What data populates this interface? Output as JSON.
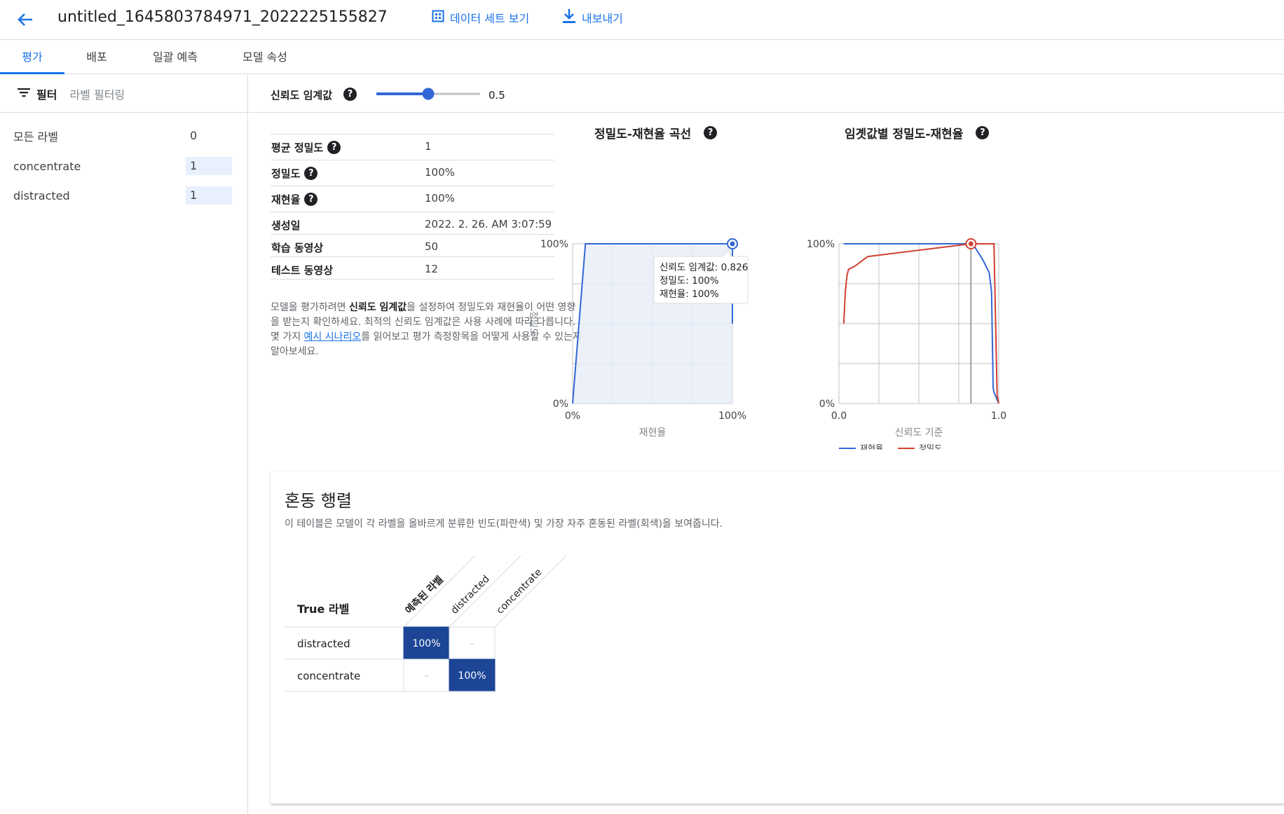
{
  "header": {
    "title": "untitled_1645803784971_2022225155827",
    "view_dataset_label": "데이터 세트 보기",
    "export_label": "내보내기"
  },
  "tabs": [
    {
      "label": "평가",
      "active": true
    },
    {
      "label": "배포",
      "active": false
    },
    {
      "label": "일괄 예측",
      "active": false
    },
    {
      "label": "모델 속성",
      "active": false
    }
  ],
  "sidebar": {
    "filter_label": "필터",
    "filter_placeholder": "라벨 필터링",
    "labels": [
      {
        "name": "모든 라벨",
        "count": "0"
      },
      {
        "name": "concentrate",
        "count": "1"
      },
      {
        "name": "distracted",
        "count": "1"
      }
    ]
  },
  "threshold": {
    "label": "신뢰도 임계값",
    "value": "0.5",
    "value_fraction": 0.5
  },
  "metrics": [
    {
      "key": "평균 정밀도",
      "value": "1",
      "help": true
    },
    {
      "key": "정밀도",
      "value": "100%",
      "help": true
    },
    {
      "key": "재현율",
      "value": "100%",
      "help": true
    },
    {
      "key": "생성일",
      "value": "2022. 2. 26. AM 3:07:59",
      "help": false
    },
    {
      "key": "학습 동영상",
      "value": "50",
      "help": false
    },
    {
      "key": "테스트 동영상",
      "value": "12",
      "help": false
    }
  ],
  "description": {
    "p1": "모델을 평가하려면 ",
    "bold": "신뢰도 임계값",
    "p2": "을 설정하여 정밀도와 재현율이 어떤 영향을 받는지 확인하세요. 최적의 신뢰도 임계값은 사용 사례에 따라 다릅니다. 몇 가지 ",
    "link": "예시 시나리오",
    "p3": "를 읽어보고 평가 측정항목을 어떻게 사용할 수 있는지 알아보세요."
  },
  "chart_data": [
    {
      "type": "area",
      "title": "정밀도-재현율 곡선",
      "xlabel": "재현율",
      "ylabel": "정밀도",
      "xlim": [
        0,
        100
      ],
      "ylim": [
        0,
        100
      ],
      "x_ticks": [
        "0%",
        "100%"
      ],
      "y_ticks": [
        "0%",
        "100%"
      ],
      "grid": true,
      "series": [
        {
          "x": [
            0,
            8,
            100,
            100
          ],
          "y": [
            0,
            100,
            100,
            50
          ]
        }
      ],
      "highlight": {
        "x": 100,
        "y": 100
      },
      "tooltip": {
        "line1": "신뢰도 임계값: 0.826",
        "line2": "정밀도: 100%",
        "line3": "재현율: 100%"
      }
    },
    {
      "type": "line",
      "title": "임곗값별 정밀도-재현율",
      "xlabel": "신뢰도 기준",
      "ylabel": "",
      "xlim": [
        0,
        1
      ],
      "ylim": [
        0,
        100
      ],
      "x_ticks": [
        "0.0",
        "1.0"
      ],
      "y_ticks": [
        "0%",
        "100%"
      ],
      "grid": true,
      "legend_position": "bottom",
      "series": [
        {
          "name": "재현율",
          "color": "#3367d6",
          "x": [
            0.03,
            0.826,
            0.85,
            0.9,
            0.94,
            0.955,
            0.96,
            0.965,
            0.97,
            1.0
          ],
          "y": [
            100,
            100,
            98,
            90,
            82,
            70,
            40,
            10,
            7,
            0
          ]
        },
        {
          "name": "정밀도",
          "color": "#d23f31",
          "x": [
            0.03,
            0.04,
            0.05,
            0.06,
            0.1,
            0.18,
            0.826,
            0.96,
            0.97,
            0.99,
            1.0
          ],
          "y": [
            50,
            70,
            80,
            84,
            86,
            92,
            100,
            100,
            100,
            5,
            0
          ]
        }
      ],
      "highlight": {
        "x": 0.826,
        "y": 100
      }
    }
  ],
  "confusion_matrix": {
    "title": "혼동 행렬",
    "subtitle": "이 테이블은 모델이 각 라벨을 올바르게 분류한 빈도(파란색) 및 가장 자주 혼동된 라벨(회색)을 보여줍니다.",
    "row_header": "True 라벨",
    "predicted_header": "예측된 라벨",
    "columns": [
      "distracted",
      "concentrate"
    ],
    "rows": [
      {
        "label": "distracted",
        "cells": [
          "100%",
          "–"
        ]
      },
      {
        "label": "concentrate",
        "cells": [
          "–",
          "100%"
        ]
      }
    ],
    "accent": "#1c4595"
  }
}
